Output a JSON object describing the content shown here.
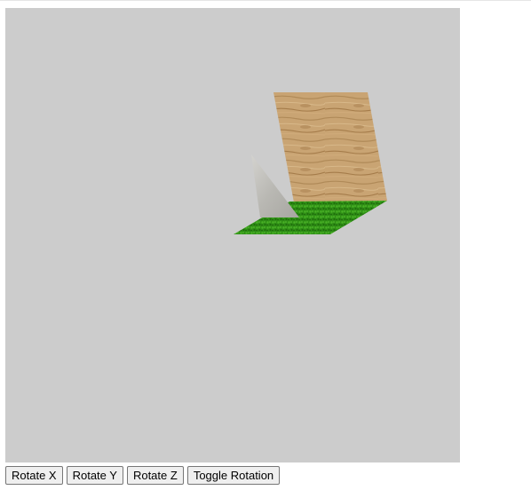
{
  "controls": {
    "rotate_x_label": "Rotate X",
    "rotate_y_label": "Rotate Y",
    "rotate_z_label": "Rotate Z",
    "toggle_rotation_label": "Toggle Rotation"
  },
  "scene": {
    "background_color": "#cccccc",
    "objects": [
      "wood-textured-plane",
      "stone-textured-triangle",
      "grass-textured-ground-plane"
    ]
  }
}
